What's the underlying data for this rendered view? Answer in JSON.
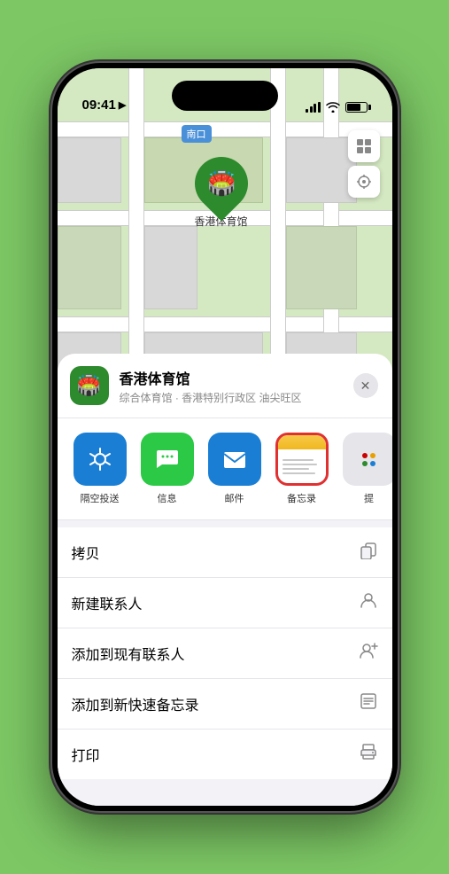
{
  "status_bar": {
    "time": "09:41",
    "location_arrow": "▶"
  },
  "map": {
    "label": "南口",
    "pin_label": "香港体育馆"
  },
  "location_card": {
    "name": "香港体育馆",
    "subtitle": "综合体育馆 · 香港特别行政区 油尖旺区",
    "close_label": "✕"
  },
  "share_items": [
    {
      "id": "airdrop",
      "label": "隔空投送"
    },
    {
      "id": "messages",
      "label": "信息"
    },
    {
      "id": "mail",
      "label": "邮件"
    },
    {
      "id": "notes",
      "label": "备忘录",
      "selected": true
    },
    {
      "id": "more",
      "label": "提"
    }
  ],
  "menu_items": [
    {
      "id": "copy",
      "text": "拷贝",
      "icon": "copy"
    },
    {
      "id": "new-contact",
      "text": "新建联系人",
      "icon": "person"
    },
    {
      "id": "add-existing",
      "text": "添加到现有联系人",
      "icon": "person-add"
    },
    {
      "id": "add-notes",
      "text": "添加到新快速备忘录",
      "icon": "note"
    },
    {
      "id": "print",
      "text": "打印",
      "icon": "printer"
    }
  ]
}
